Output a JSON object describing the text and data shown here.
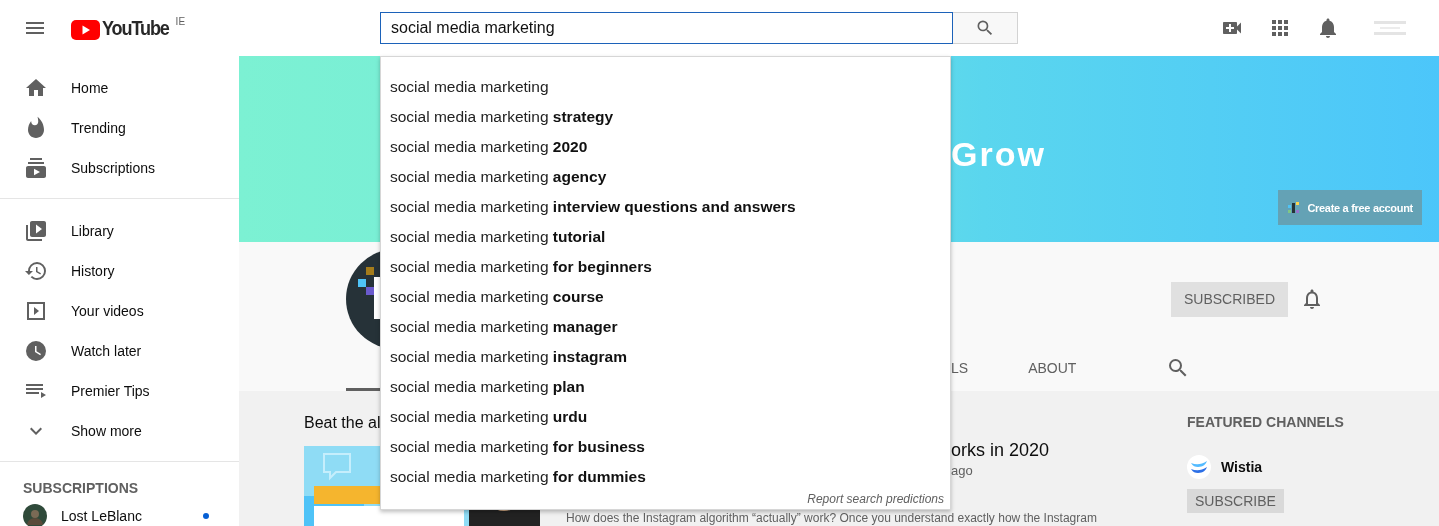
{
  "header": {
    "logo": {
      "text": "YouTube",
      "region": "IE"
    },
    "search": {
      "value": "social media marketing"
    }
  },
  "sidebar": {
    "sections": [
      {
        "items": [
          {
            "label": "Home",
            "selected": false
          },
          {
            "label": "Trending",
            "selected": false
          },
          {
            "label": "Subscriptions",
            "selected": false
          }
        ]
      },
      {
        "items": [
          {
            "label": "Library",
            "selected": false
          },
          {
            "label": "History",
            "selected": false
          },
          {
            "label": "Your videos",
            "selected": false
          },
          {
            "label": "Watch later",
            "selected": false
          },
          {
            "label": "Premier Tips",
            "selected": false
          },
          {
            "label": "Show more",
            "selected": false
          }
        ]
      }
    ],
    "subscriptions": {
      "heading": "SUBSCRIPTIONS",
      "channels": [
        {
          "name": "Lost LeBlanc",
          "has_new": true
        }
      ]
    }
  },
  "banner": {
    "headline": "Grow",
    "cta": "Create a free account"
  },
  "channel": {
    "subscribe": "SUBSCRIBED",
    "tabs": [
      {
        "label": "LS"
      },
      {
        "label": "ABOUT"
      }
    ]
  },
  "content": {
    "section_title": "Beat the al",
    "video": {
      "title": "orks in 2020",
      "meta": "ago",
      "description": "How does the Instagram algorithm “actually” work? Once you understand exactly how the Instagram"
    },
    "featured": {
      "heading": "FEATURED CHANNELS",
      "channels": [
        {
          "name": "Wistia",
          "subscribe": "SUBSCRIBE"
        }
      ]
    }
  },
  "suggestions": {
    "items": [
      "social media marketing",
      "social media marketing **strategy**",
      "social media marketing **2020**",
      "social media marketing **agency**",
      "social media marketing **interview questions and answers**",
      "social media marketing **tutorial**",
      "social media marketing **for beginners**",
      "social media marketing **course**",
      "social media marketing **manager**",
      "social media marketing **instagram**",
      "social media marketing **plan**",
      "social media marketing **urdu**",
      "social media marketing **for business**",
      "social media marketing **for dummies**"
    ],
    "report": "Report search predictions"
  }
}
